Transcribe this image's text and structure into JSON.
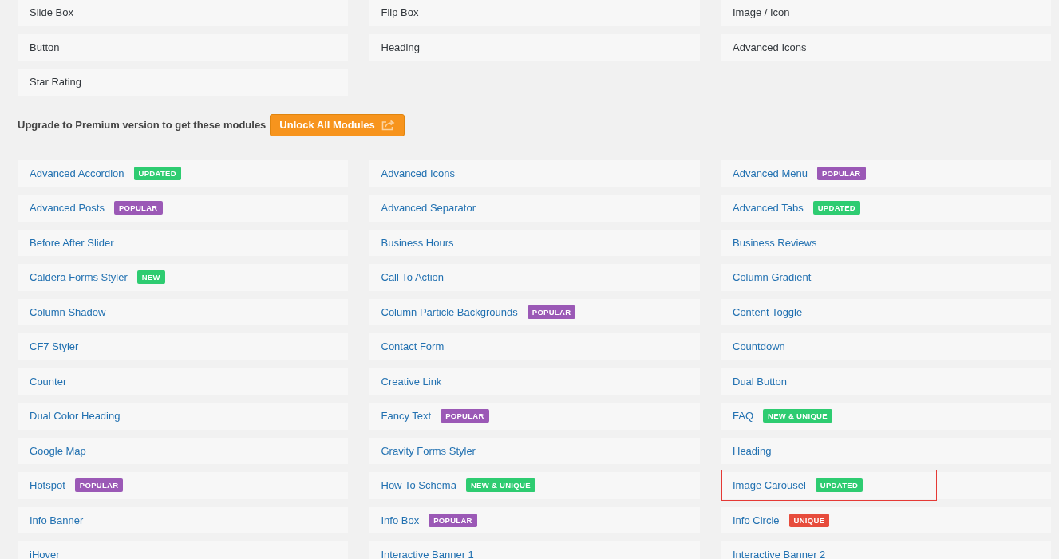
{
  "active_modules": {
    "items": [
      {
        "label": "Slide Box"
      },
      {
        "label": "Flip Box"
      },
      {
        "label": "Image / Icon"
      },
      {
        "label": "Button"
      },
      {
        "label": "Heading"
      },
      {
        "label": "Advanced Icons"
      },
      {
        "label": "Star Rating"
      }
    ]
  },
  "upgrade_bar": {
    "message": "Upgrade to Premium version to get these modules",
    "button": "Unlock All Modules"
  },
  "premium_modules": {
    "items": [
      {
        "label": "Advanced Accordion",
        "badge": {
          "text": "UPDATED",
          "color": "#2ecc71"
        },
        "highlighted": false
      },
      {
        "label": "Advanced Icons",
        "highlighted": false
      },
      {
        "label": "Advanced Menu",
        "badge": {
          "text": "POPULAR",
          "color": "#9b59b6"
        },
        "highlighted": false
      },
      {
        "label": "Advanced Posts",
        "badge": {
          "text": "POPULAR",
          "color": "#9b59b6"
        },
        "highlighted": false
      },
      {
        "label": "Advanced Separator",
        "highlighted": false
      },
      {
        "label": "Advanced Tabs",
        "badge": {
          "text": "UPDATED",
          "color": "#2ecc71"
        },
        "highlighted": false
      },
      {
        "label": "Before After Slider",
        "highlighted": false
      },
      {
        "label": "Business Hours",
        "highlighted": false
      },
      {
        "label": "Business Reviews",
        "highlighted": false
      },
      {
        "label": "Caldera Forms Styler",
        "badge": {
          "text": "NEW",
          "color": "#2ecc71"
        },
        "highlighted": false
      },
      {
        "label": "Call To Action",
        "highlighted": false
      },
      {
        "label": "Column Gradient",
        "highlighted": false
      },
      {
        "label": "Column Shadow",
        "highlighted": false
      },
      {
        "label": "Column Particle Backgrounds",
        "badge": {
          "text": "POPULAR",
          "color": "#9b59b6"
        },
        "highlighted": false
      },
      {
        "label": "Content Toggle",
        "highlighted": false
      },
      {
        "label": "CF7 Styler",
        "highlighted": false
      },
      {
        "label": "Contact Form",
        "highlighted": false
      },
      {
        "label": "Countdown",
        "highlighted": false
      },
      {
        "label": "Counter",
        "highlighted": false
      },
      {
        "label": "Creative Link",
        "highlighted": false
      },
      {
        "label": "Dual Button",
        "highlighted": false
      },
      {
        "label": "Dual Color Heading",
        "highlighted": false
      },
      {
        "label": "Fancy Text",
        "badge": {
          "text": "POPULAR",
          "color": "#9b59b6"
        },
        "highlighted": false
      },
      {
        "label": "FAQ",
        "badge": {
          "text": "NEW & UNIQUE",
          "color": "#2ecc71"
        },
        "highlighted": false
      },
      {
        "label": "Google Map",
        "highlighted": false
      },
      {
        "label": "Gravity Forms Styler",
        "highlighted": false
      },
      {
        "label": "Heading",
        "highlighted": false
      },
      {
        "label": "Hotspot",
        "badge": {
          "text": "POPULAR",
          "color": "#9b59b6"
        },
        "highlighted": false
      },
      {
        "label": "How To Schema",
        "badge": {
          "text": "NEW & UNIQUE",
          "color": "#2ecc71"
        },
        "highlighted": false
      },
      {
        "label": "Image Carousel",
        "badge": {
          "text": "UPDATED",
          "color": "#2ecc71"
        },
        "highlighted": true
      },
      {
        "label": "Info Banner",
        "highlighted": false
      },
      {
        "label": "Info Box",
        "badge": {
          "text": "POPULAR",
          "color": "#9b59b6"
        },
        "highlighted": false
      },
      {
        "label": "Info Circle",
        "badge": {
          "text": "UNIQUE",
          "color": "#e74c3c"
        },
        "highlighted": false
      },
      {
        "label": "iHover",
        "highlighted": false
      },
      {
        "label": "Interactive Banner 1",
        "highlighted": false
      },
      {
        "label": "Interactive Banner 2",
        "highlighted": false
      }
    ]
  }
}
